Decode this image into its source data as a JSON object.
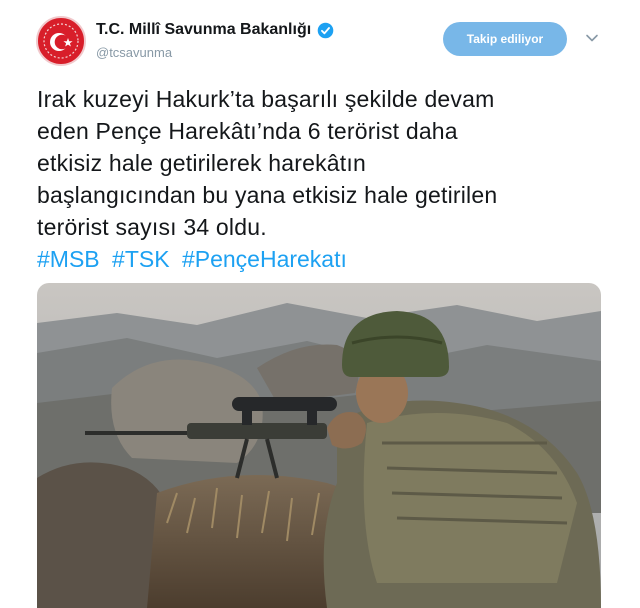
{
  "account": {
    "display_name": "T.C. Millî Savunma Bakanlığı",
    "handle": "@tcsavunma",
    "verified": true,
    "follow_label": "Takip ediliyor",
    "avatar_icon": "crescent-star-emblem-icon",
    "brand_color": "#d81e2a"
  },
  "tweet": {
    "lines": [
      "Irak kuzeyi Hakurk’ta başarılı şekilde devam",
      "eden Pençe Harekâtı’nda 6 terörist daha",
      "etkisiz hale getirilerek harekâtın",
      "başlangıcından bu yana etkisiz hale getirilen",
      "terörist sayısı 34 oldu."
    ],
    "hashtags": [
      "#MSB",
      "#TSK",
      "#PençeHarekatı"
    ]
  },
  "colors": {
    "text": "#14171a",
    "muted": "#8899a6",
    "link": "#1da1f2",
    "follow_button": "#78b7e8"
  }
}
